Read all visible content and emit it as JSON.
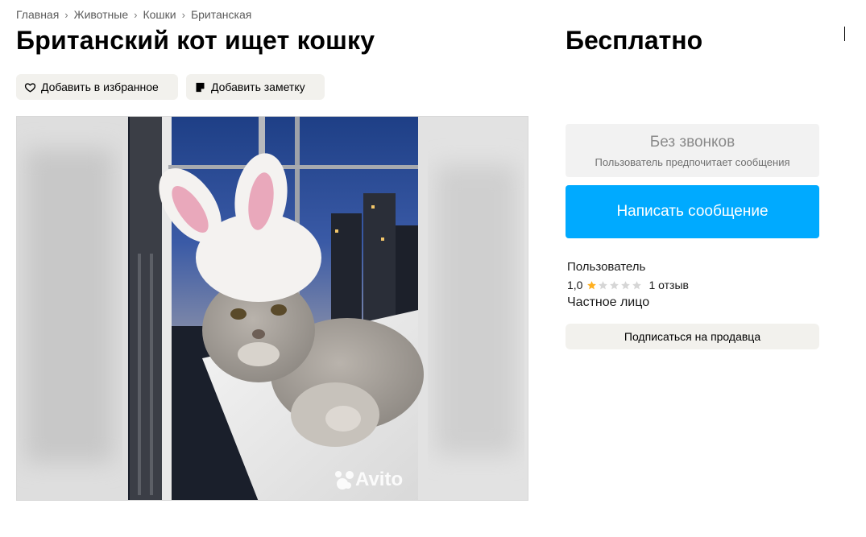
{
  "breadcrumb": [
    "Главная",
    "Животные",
    "Кошки",
    "Британская"
  ],
  "listing": {
    "title": "Британский кот ищет кошку",
    "price": "Бесплатно"
  },
  "actions": {
    "favorite_label": "Добавить в избранное",
    "note_label": "Добавить заметку"
  },
  "gallery": {
    "watermark": "Avito"
  },
  "contact": {
    "no_calls_title": "Без звонков",
    "no_calls_subtitle": "Пользователь предпочитает сообщения",
    "message_button": "Написать сообщение"
  },
  "seller": {
    "name": "Пользователь",
    "rating": "1,0",
    "reviews": "1 отзыв",
    "type": "Частное лицо",
    "subscribe_label": "Подписаться на продавца",
    "stars_filled": 1,
    "stars_total": 5
  },
  "colors": {
    "accent": "#00aaff",
    "chip_bg": "#f2f1ed",
    "star_filled": "#ffb021",
    "star_empty": "#d6d6d6"
  },
  "icons": [
    "heart-icon",
    "note-icon",
    "star-icon"
  ]
}
